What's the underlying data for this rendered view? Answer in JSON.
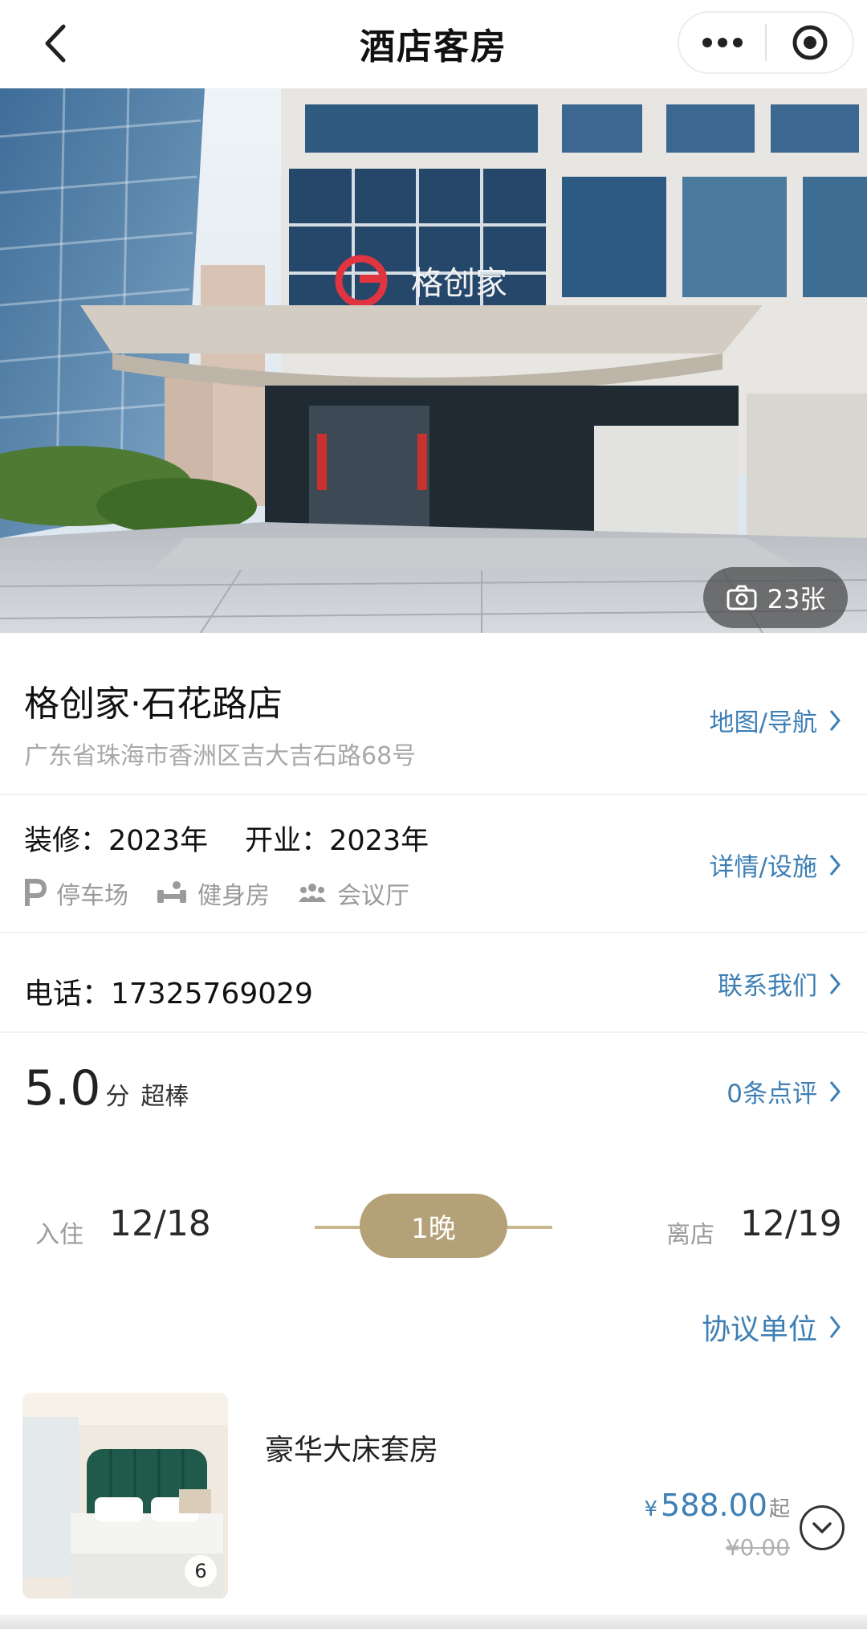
{
  "header": {
    "title": "酒店客房"
  },
  "hero": {
    "photo_count": "23张"
  },
  "hotel": {
    "name": "格创家·石花路店",
    "address": "广东省珠海市香洲区吉大吉石路68号",
    "map_link": "地图/导航",
    "renovation": "装修：2023年",
    "opened": "开业：2023年",
    "details_link": "详情/设施",
    "amenities": [
      "停车场",
      "健身房",
      "会议厅"
    ],
    "phone": "电话：17325769029",
    "contact_link": "联系我们",
    "score": "5.0",
    "score_unit": "分",
    "score_text": "超棒",
    "reviews_link": "0条点评"
  },
  "dates": {
    "checkin_label": "入住",
    "checkin": "12/18",
    "nights": "1晚",
    "checkout_label": "离店",
    "checkout": "12/19"
  },
  "agreement_link": "协议单位",
  "room": {
    "name": "豪华大床套房",
    "photo_count": "6",
    "currency": "¥",
    "price": "588.00",
    "price_suffix": "起",
    "original_price": "¥0.00"
  },
  "colors": {
    "link": "#3d7fb5",
    "accent": "#b5a178"
  }
}
